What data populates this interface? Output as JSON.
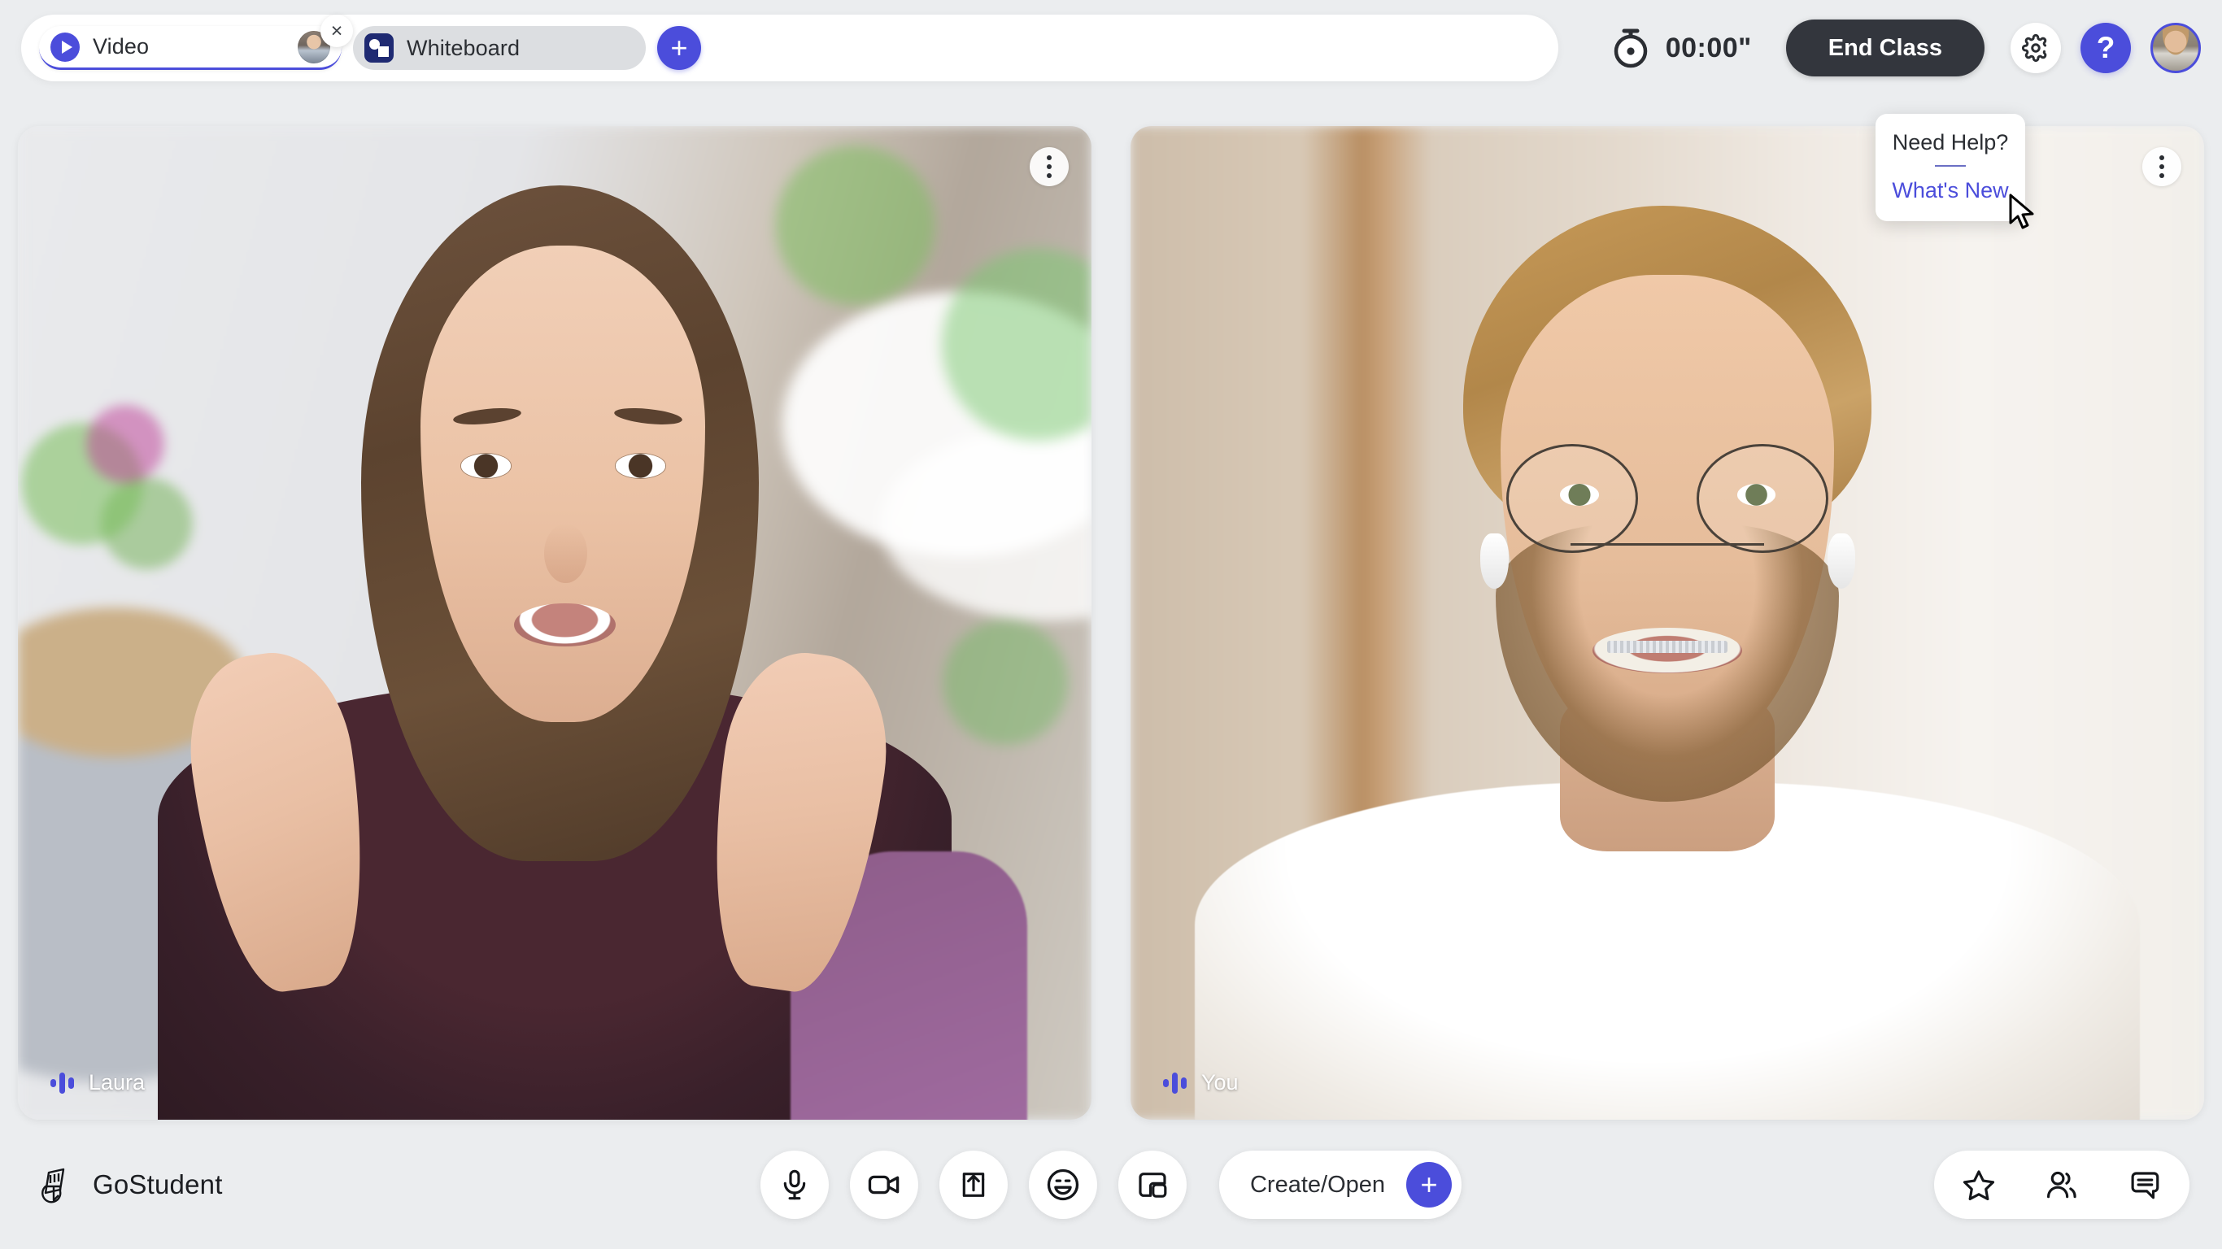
{
  "app": {
    "brand_name": "GoStudent",
    "background_color": "#ebedef",
    "accent_color": "#4b4ddb",
    "dark_color": "#33363d"
  },
  "topbar": {
    "tabs": [
      {
        "label": "Video",
        "icon": "play-circle-icon",
        "active": true,
        "has_avatar": true,
        "closable": true,
        "close_label": "×"
      },
      {
        "label": "Whiteboard",
        "icon": "whiteboard-icon",
        "active": false,
        "has_avatar": false,
        "closable": false
      }
    ],
    "add_tab_label": "+",
    "timer": {
      "icon": "stopwatch-icon",
      "value": "00:00\""
    },
    "end_class_label": "End Class",
    "settings_icon": "gear-icon",
    "help_icon": "question-mark-icon",
    "help_label": "?",
    "user_avatar": "user-avatar"
  },
  "help_popup": {
    "title": "Need Help?",
    "link_label": "What's New",
    "visible": true
  },
  "tiles": [
    {
      "name": "Laura",
      "menu_icon": "more-vertical-icon",
      "audio_active": true
    },
    {
      "name": "You",
      "menu_icon": "more-vertical-icon",
      "audio_active": true
    }
  ],
  "bottombar": {
    "controls": [
      {
        "name": "microphone-button",
        "icon": "microphone-icon"
      },
      {
        "name": "camera-button",
        "icon": "video-camera-icon"
      },
      {
        "name": "share-screen-button",
        "icon": "share-upload-icon"
      },
      {
        "name": "reactions-button",
        "icon": "smiley-face-icon"
      },
      {
        "name": "picture-in-picture-button",
        "icon": "picture-in-picture-icon"
      }
    ],
    "create_open_label": "Create/Open",
    "create_open_plus": "+",
    "right_controls": [
      {
        "name": "favorites-button",
        "icon": "star-icon"
      },
      {
        "name": "participants-button",
        "icon": "people-icon"
      },
      {
        "name": "chat-button",
        "icon": "chat-bubble-icon"
      }
    ]
  }
}
